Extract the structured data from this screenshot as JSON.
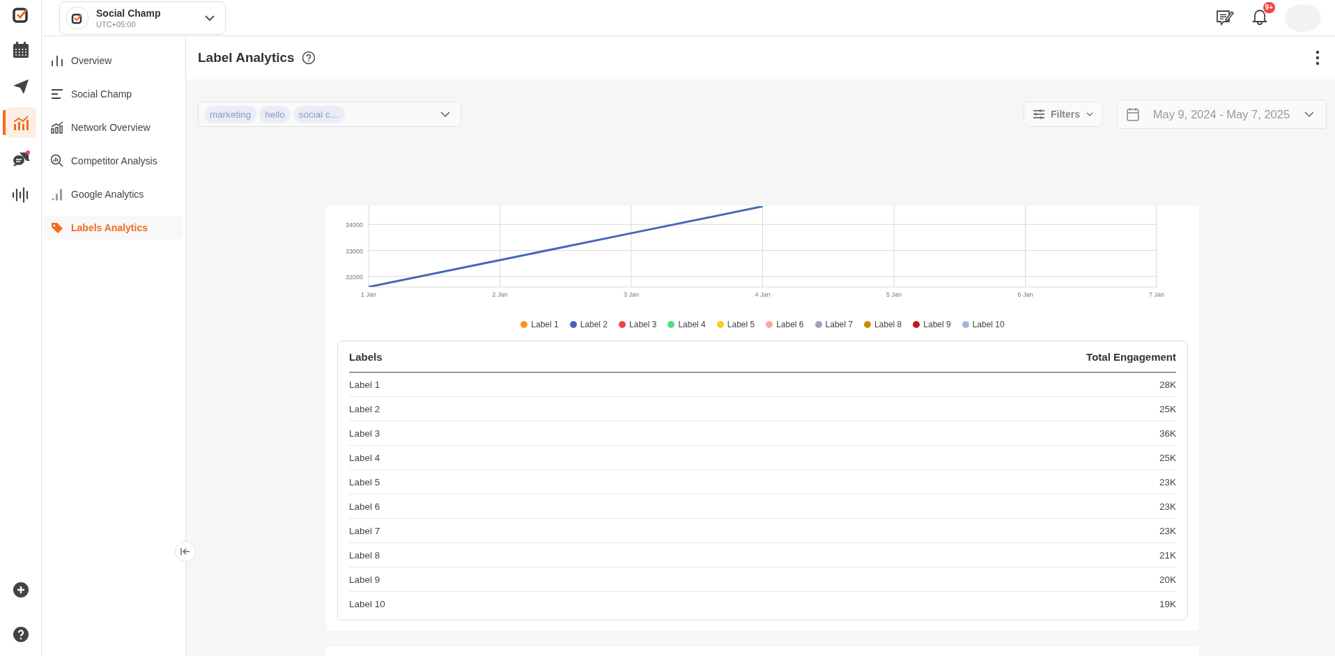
{
  "rail": [
    {
      "kind": "calendar",
      "selected": false
    },
    {
      "kind": "send",
      "selected": false
    },
    {
      "kind": "analytics",
      "selected": true
    },
    {
      "kind": "chat",
      "selected": false
    },
    {
      "kind": "listen",
      "selected": false
    }
  ],
  "account": {
    "name": "Social Champ",
    "timezone": "UTC+05:00"
  },
  "notifications": {
    "badge": "9+"
  },
  "sidebar": {
    "items": [
      {
        "kind": "bars",
        "label": "Overview",
        "selected": false
      },
      {
        "kind": "lines",
        "label": "Social Champ",
        "selected": false
      },
      {
        "kind": "growth",
        "label": "Network Overview",
        "selected": false
      },
      {
        "kind": "magnifier",
        "label": "Competitor Analysis",
        "selected": false
      },
      {
        "kind": "signal",
        "label": "Google Analytics",
        "selected": false
      },
      {
        "kind": "tag",
        "label": "Labels Analytics",
        "selected": true
      }
    ]
  },
  "page": {
    "title": "Label Analytics"
  },
  "label_select": {
    "tags": [
      "marketing",
      "hello",
      "social c…"
    ]
  },
  "filters": {
    "label": "Filters"
  },
  "date_range": {
    "value": "May 9, 2024 - May 7, 2025"
  },
  "chart": {
    "chart_data": {
      "type": "line",
      "x": [
        "1 Jan",
        "2 Jan",
        "3 Jan",
        "4 Jan",
        "5 Jan",
        "6 Jan",
        "7 Jan"
      ],
      "ylim": [
        31600,
        34700
      ],
      "grid": true,
      "yticks": [
        32000,
        33000,
        34000
      ],
      "series": [
        {
          "name": "Label 1",
          "color": "#f7931e",
          "values": [
            null,
            null,
            null,
            null,
            null,
            null,
            null
          ]
        },
        {
          "name": "Label 2",
          "color": "#4468b8",
          "values": [
            31600,
            32630,
            33660,
            34690,
            null,
            null,
            null
          ]
        },
        {
          "name": "Label 3",
          "color": "#ef4444",
          "values": [
            null,
            null,
            null,
            null,
            null,
            null,
            null
          ]
        },
        {
          "name": "Label 4",
          "color": "#4ade80",
          "values": [
            null,
            null,
            null,
            null,
            null,
            null,
            null
          ]
        },
        {
          "name": "Label 5",
          "color": "#facc15",
          "values": [
            null,
            null,
            null,
            null,
            null,
            null,
            null
          ]
        },
        {
          "name": "Label 6",
          "color": "#fca5a5",
          "values": [
            null,
            null,
            null,
            null,
            null,
            null,
            null
          ]
        },
        {
          "name": "Label 7",
          "color": "#9ca3b8",
          "values": [
            null,
            null,
            null,
            null,
            null,
            null,
            null
          ]
        },
        {
          "name": "Label 8",
          "color": "#ca8a04",
          "values": [
            null,
            null,
            null,
            null,
            null,
            null,
            null
          ]
        },
        {
          "name": "Label 9",
          "color": "#b91c1c",
          "values": [
            null,
            null,
            null,
            null,
            null,
            null,
            null
          ]
        },
        {
          "name": "Label 10",
          "color": "#a5b4dc",
          "values": [
            null,
            null,
            null,
            null,
            null,
            null,
            null
          ]
        }
      ]
    }
  },
  "table": {
    "columns": [
      "Labels",
      "Total Engagement"
    ],
    "rows": [
      [
        "Label 1",
        "28K"
      ],
      [
        "Label 2",
        "25K"
      ],
      [
        "Label 3",
        "36K"
      ],
      [
        "Label 4",
        "25K"
      ],
      [
        "Label 5",
        "23K"
      ],
      [
        "Label 6",
        "23K"
      ],
      [
        "Label 7",
        "23K"
      ],
      [
        "Label 8",
        "21K"
      ],
      [
        "Label 9",
        "20K"
      ],
      [
        "Label 10",
        "19K"
      ]
    ]
  }
}
